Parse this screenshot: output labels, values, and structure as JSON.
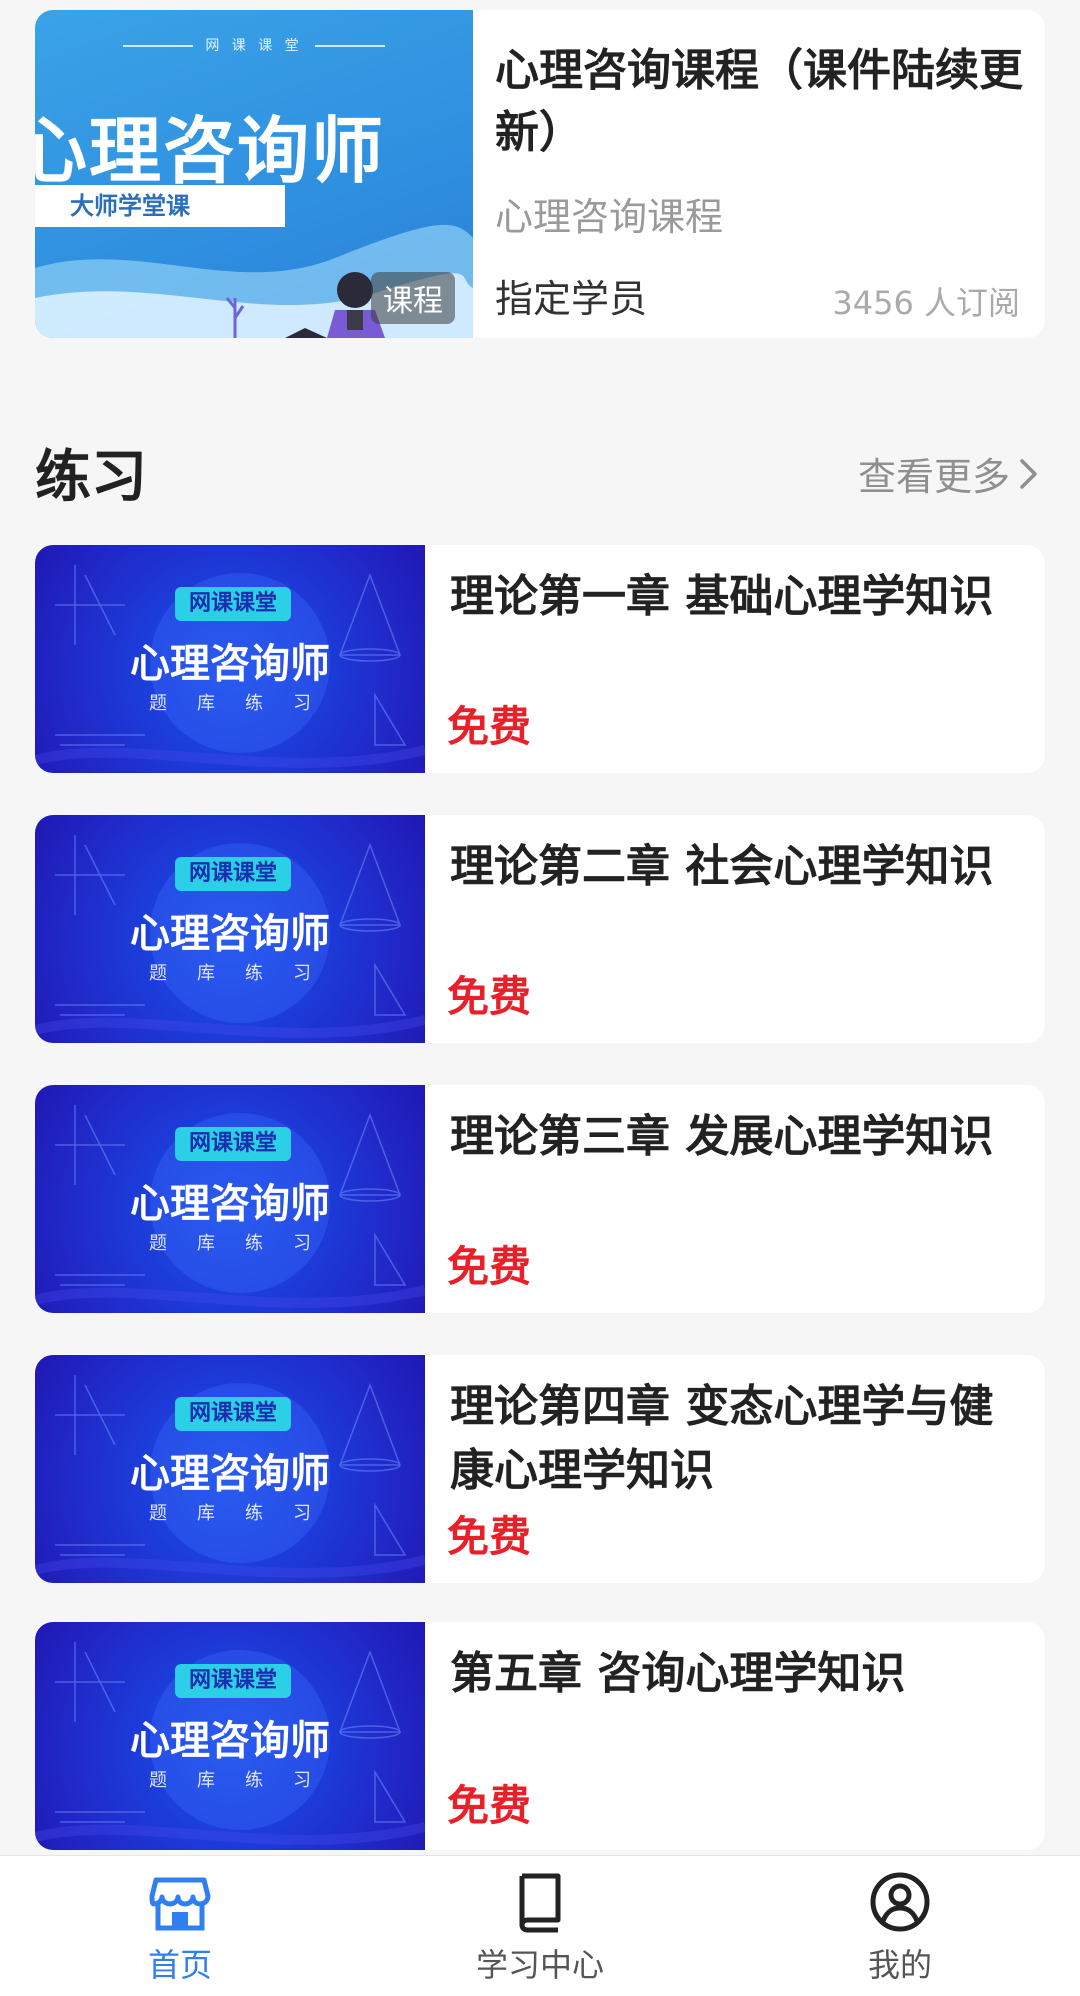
{
  "course": {
    "thumb_top_text": "网 课 课 堂",
    "thumb_big_text": "心理咨询师",
    "thumb_sub_text": "大师学堂课",
    "badge": "课程",
    "title": "心理咨询课程（课件陆续更新）",
    "subtitle": "心理咨询课程",
    "audience": "指定学员",
    "subscribers": "3456 人订阅"
  },
  "practice_section": {
    "title": "练习",
    "more_label": "查看更多"
  },
  "practice_thumb": {
    "brand": "网课课堂",
    "main": "心理咨询师",
    "sub": "题库练习"
  },
  "practice_items": [
    {
      "title": "理论第一章 基础心理学知识",
      "price": "免费"
    },
    {
      "title": "理论第二章 社会心理学知识",
      "price": "免费"
    },
    {
      "title": "理论第三章 发展心理学知识",
      "price": "免费"
    },
    {
      "title": "理论第四章 变态心理学与健康心理学知识",
      "price": "免费"
    },
    {
      "title": "第五章 咨询心理学知识",
      "price": "免费"
    }
  ],
  "tabbar": {
    "tabs": [
      {
        "label": "首页",
        "icon": "store-icon",
        "active": true
      },
      {
        "label": "学习中心",
        "icon": "book-icon",
        "active": false
      },
      {
        "label": "我的",
        "icon": "user-icon",
        "active": false
      }
    ]
  },
  "colors": {
    "accent": "#2f7ff0",
    "price": "#e8202a"
  }
}
